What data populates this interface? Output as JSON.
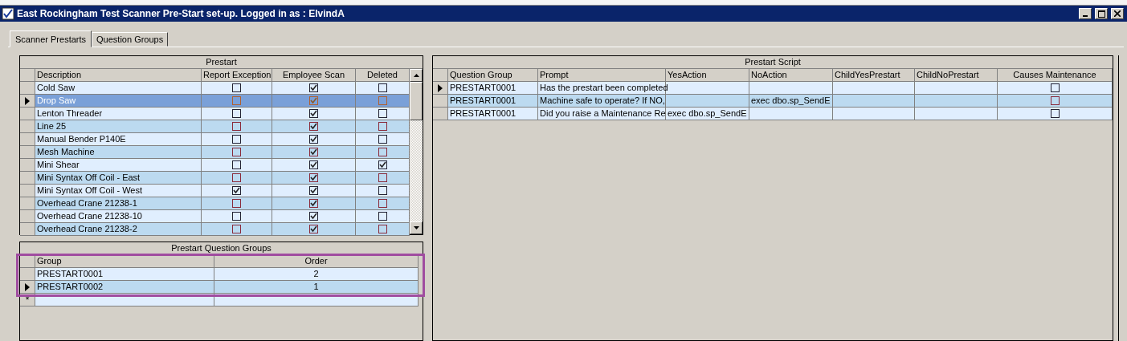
{
  "window": {
    "title": "East Rockingham Test Scanner Pre-Start set-up. Logged in as : ElvindA"
  },
  "tabs": [
    {
      "label": "Scanner Prestarts",
      "selected": true
    },
    {
      "label": "Question Groups",
      "selected": false
    }
  ],
  "prestart": {
    "title": "Prestart",
    "columns": [
      "Description",
      "Report Exception",
      "Employee Scan",
      "Deleted"
    ],
    "rows": [
      {
        "description": "Cold Saw",
        "report_exception": false,
        "employee_scan": true,
        "deleted": false,
        "selected": false
      },
      {
        "description": "Drop Saw",
        "report_exception": false,
        "employee_scan": true,
        "deleted": false,
        "selected": true
      },
      {
        "description": "Lenton Threader",
        "report_exception": false,
        "employee_scan": true,
        "deleted": false,
        "selected": false
      },
      {
        "description": "Line 25",
        "report_exception": false,
        "employee_scan": true,
        "deleted": false,
        "selected": false
      },
      {
        "description": "Manual Bender P140E",
        "report_exception": false,
        "employee_scan": true,
        "deleted": false,
        "selected": false
      },
      {
        "description": "Mesh Machine",
        "report_exception": false,
        "employee_scan": true,
        "deleted": false,
        "selected": false
      },
      {
        "description": "Mini Shear",
        "report_exception": false,
        "employee_scan": true,
        "deleted": true,
        "selected": false
      },
      {
        "description": "Mini Syntax Off Coil - East",
        "report_exception": false,
        "employee_scan": true,
        "deleted": false,
        "selected": false
      },
      {
        "description": "Mini Syntax Off Coil - West",
        "report_exception": true,
        "employee_scan": true,
        "deleted": false,
        "selected": false
      },
      {
        "description": "Overhead Crane 21238-1",
        "report_exception": false,
        "employee_scan": true,
        "deleted": false,
        "selected": false
      },
      {
        "description": "Overhead Crane 21238-10",
        "report_exception": false,
        "employee_scan": true,
        "deleted": false,
        "selected": false
      },
      {
        "description": "Overhead Crane 21238-2",
        "report_exception": false,
        "employee_scan": true,
        "deleted": false,
        "selected": false
      }
    ]
  },
  "question_groups": {
    "title": "Prestart Question Groups",
    "columns": [
      "Group",
      "Order"
    ],
    "rows": [
      {
        "group": "PRESTART0001",
        "order": "2",
        "selected": false
      },
      {
        "group": "PRESTART0002",
        "order": "1",
        "selected": true
      }
    ],
    "new_row_marker": "*"
  },
  "prestart_script": {
    "title": "Prestart Script",
    "columns": [
      "Question Group",
      "Prompt",
      "YesAction",
      "NoAction",
      "ChildYesPrestart",
      "ChildNoPrestart",
      "Causes Maintenance"
    ],
    "rows": [
      {
        "question_group": "PRESTART0001",
        "prompt": "Has the prestart been completed",
        "yes_action": "",
        "no_action": "",
        "causes_maintenance": false,
        "selected": true
      },
      {
        "question_group": "PRESTART0001",
        "prompt": "Machine safe to operate? If NO,",
        "yes_action": "",
        "no_action": "exec dbo.sp_SendE",
        "causes_maintenance": false,
        "selected": false
      },
      {
        "question_group": "PRESTART0001",
        "prompt": "Did you raise a Maintenance Re",
        "yes_action": "exec dbo.sp_SendE",
        "no_action": "",
        "causes_maintenance": false,
        "selected": false
      }
    ]
  }
}
